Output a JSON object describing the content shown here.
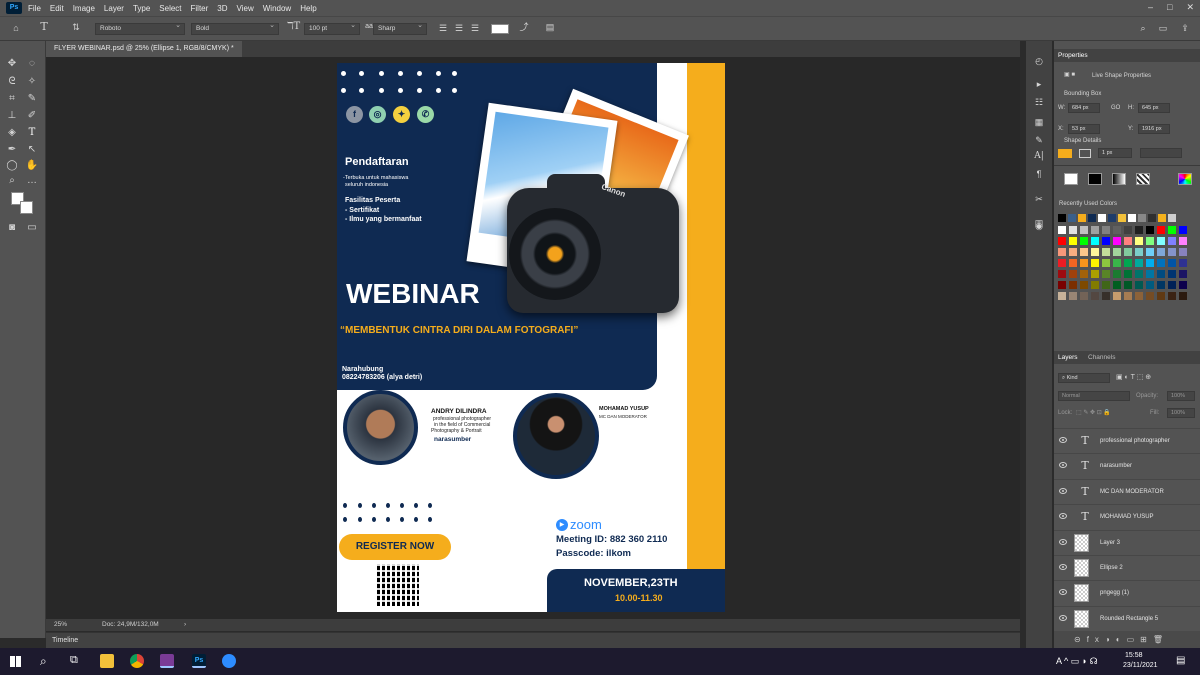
{
  "menubar": {
    "app_icon": "Ps",
    "items": [
      "File",
      "Edit",
      "Image",
      "Layer",
      "Type",
      "Select",
      "Filter",
      "3D",
      "View",
      "Window",
      "Help"
    ],
    "controls": [
      "–",
      "□",
      "✕"
    ]
  },
  "options": {
    "font_family": "Roboto",
    "font_style": "Bold",
    "font_size": "100 pt",
    "antialias": "Sharp"
  },
  "document": {
    "tab_title": "FLYER WEBINAR.psd @ 25% (Ellipse 1, RGB/8/CMYK) *"
  },
  "status": {
    "zoom": "25%",
    "doc_size": "Doc: 24,9M/132,0M"
  },
  "timeline": {
    "label": "Timeline"
  },
  "properties": {
    "tab": "Properties",
    "subtitle": "Live Shape Properties",
    "bounding_box": "Bounding Box",
    "w_label": "W:",
    "w_value": "684 px",
    "go_label": "GO",
    "h_label": "H:",
    "h_value": "645 px",
    "x_label": "X:",
    "x_value": "53 px",
    "y_label": "Y:",
    "y_value": "1916 px",
    "shape_details": "Shape Details",
    "stroke_width": "1 px"
  },
  "swatches": {
    "title": "Recently Used Colors",
    "recent": [
      "#000000",
      "#3a5f8a",
      "#f5ad1c",
      "#0f2a52",
      "#ffffff",
      "#1e3c6a",
      "#f3c13a",
      "#ffffff",
      "#888888",
      "#2f2f2f",
      "#f5b21d",
      "#cfcfcf"
    ],
    "grid": [
      "#ffffff",
      "#e0e0e0",
      "#c0c0c0",
      "#a0a0a0",
      "#808080",
      "#606060",
      "#404040",
      "#202020",
      "#000000",
      "#ff0000",
      "#00ff00",
      "#0000ff",
      "#ff0000",
      "#ffff00",
      "#00ff00",
      "#00ffff",
      "#0000ff",
      "#ff00ff",
      "#ff8080",
      "#ffff80",
      "#80ff80",
      "#80ffff",
      "#8080ff",
      "#ff80ff",
      "#f7977a",
      "#f9ad81",
      "#fdc68a",
      "#fff79a",
      "#c4df9b",
      "#a2d39c",
      "#82ca9d",
      "#7bcdc8",
      "#6ecff6",
      "#7ea7d8",
      "#8493ca",
      "#8882be",
      "#ed1c24",
      "#f26522",
      "#f7941d",
      "#fff200",
      "#8dc63f",
      "#39b54a",
      "#00a651",
      "#00a99d",
      "#00aeef",
      "#0072bc",
      "#0054a6",
      "#2e3192",
      "#9e0b0f",
      "#a0410d",
      "#a36209",
      "#aba000",
      "#598527",
      "#1a7b30",
      "#007236",
      "#00746b",
      "#0076a3",
      "#004b80",
      "#003471",
      "#1b1464",
      "#790000",
      "#7b2e00",
      "#7d4900",
      "#827b00",
      "#406618",
      "#005e20",
      "#005826",
      "#005952",
      "#005b7f",
      "#003663",
      "#002157",
      "#0d004c",
      "#c7b299",
      "#998675",
      "#736357",
      "#534741",
      "#37302a",
      "#c69c6d",
      "#a67c52",
      "#8c6239",
      "#754c24",
      "#603913",
      "#3b2314",
      "#2b1a0f"
    ]
  },
  "layers": {
    "tabs": [
      "Layers",
      "Channels"
    ],
    "kind": "Kind",
    "blend_mode": "Normal",
    "opacity_label": "Opacity:",
    "opacity_value": "100%",
    "lock_label": "Lock:",
    "fill_label": "Fill:",
    "fill_value": "100%",
    "rows": [
      {
        "type": "text",
        "name": "professional photographer"
      },
      {
        "type": "text",
        "name": "narasumber"
      },
      {
        "type": "text",
        "name": "MC DAN MODERATOR"
      },
      {
        "type": "text",
        "name": "MOHAMAD YUSUP"
      },
      {
        "type": "pixel",
        "name": "Layer 3"
      },
      {
        "type": "shape",
        "name": "Ellipse 2"
      },
      {
        "type": "pixel",
        "name": "pngegg (1)"
      },
      {
        "type": "shape",
        "name": "Rounded Rectangle 5"
      }
    ]
  },
  "taskbar": {
    "time": "15:58",
    "date": "23/11/2021"
  },
  "flyer": {
    "pendaftaran": "Pendaftaran",
    "open_for": "-Terbuka untuk mahasiswa",
    "open_for2": "seluruh indonesia",
    "facilities": "Fasilitas Peserta",
    "facility1": "- Sertifikat",
    "facility2": "- Ilmu yang bermanfaat",
    "webinar": "WEBINAR",
    "tagline": "“MEMBENTUK CINTRA DIRI DALAM FOTOGRAFI”",
    "contact_label": "Narahubung",
    "contact_value": "08224783206 (alya detri)",
    "speaker1_name": "ANDRY DILINDRA",
    "speaker1_desc1": "professional photographer",
    "speaker1_desc2": "in the field of Commercial",
    "speaker1_desc3": "Photography & Portrait",
    "speaker1_role": "narasumber",
    "speaker2_name": "MOHAMAD YUSUP",
    "speaker2_role": "MC DAN MODERATOR",
    "register": "REGISTER NOW",
    "zoom": "zoom",
    "meeting": "Meeting ID: 882 360 2110",
    "passcode": "Passcode: ilkom",
    "date": "NOVEMBER,23TH",
    "time": "10.00-11.30",
    "camera_brand": "Canon"
  },
  "colors": {
    "navy": "#0f2a52",
    "yellow": "#f5ad1c",
    "ps_bg": "#535353"
  }
}
